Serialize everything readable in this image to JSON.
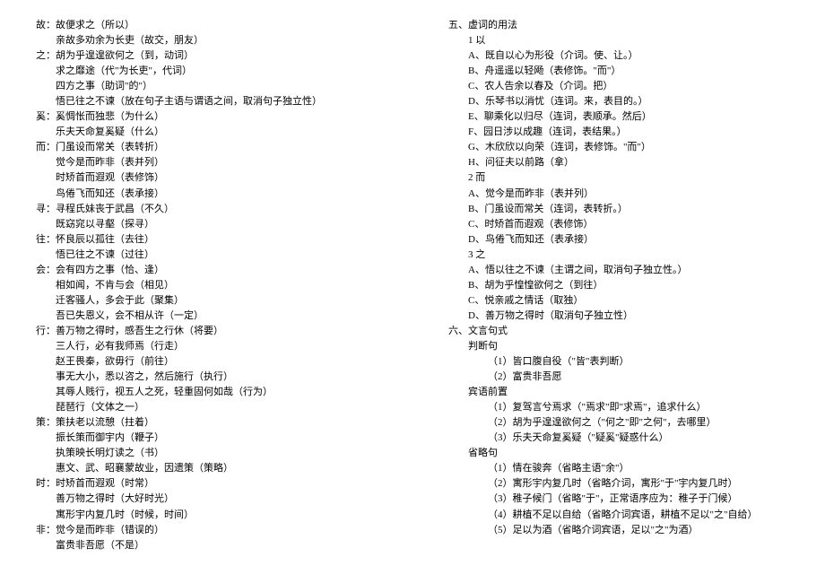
{
  "left": [
    {
      "indent": 0,
      "text": "故：故便求之（所以）"
    },
    {
      "indent": 1,
      "text": "亲故多劝余为长吏（故交，朋友）"
    },
    {
      "indent": 0,
      "text": "之：胡为乎遑遑欲何之（到，动词）"
    },
    {
      "indent": 1,
      "text": "求之靡途（代\"为长吏\"，代词）"
    },
    {
      "indent": 1,
      "text": "四方之事（助词\"的\"）"
    },
    {
      "indent": 1,
      "text": "悟已往之不谏（放在句子主语与谓语之间，取消句子独立性）"
    },
    {
      "indent": 0,
      "text": "奚：奚惆怅而独悲（为什么）"
    },
    {
      "indent": 1,
      "text": "乐夫天命复奚疑（什么）"
    },
    {
      "indent": 0,
      "text": "而：门虽设而常关（表转折）"
    },
    {
      "indent": 1,
      "text": "觉今是而昨非（表并列）"
    },
    {
      "indent": 1,
      "text": "时矫首而遐观（表修饰）"
    },
    {
      "indent": 1,
      "text": "鸟倦飞而知还（表承接）"
    },
    {
      "indent": 0,
      "text": "寻：寻程氏妹丧于武昌（不久）"
    },
    {
      "indent": 1,
      "text": "既窈窕以寻壑（探寻）"
    },
    {
      "indent": 0,
      "text": "往：怀良辰以孤往（去往）"
    },
    {
      "indent": 1,
      "text": "悟已往之不谏（过往）"
    },
    {
      "indent": 0,
      "text": "会：会有四方之事（恰、逢）"
    },
    {
      "indent": 1,
      "text": "相如闻，不肯与会（相见）"
    },
    {
      "indent": 1,
      "text": "迁客骚人，多会于此（聚集）"
    },
    {
      "indent": 1,
      "text": "吾已失恩义，会不相从许（一定）"
    },
    {
      "indent": 0,
      "text": "行：善万物之得时，感吾生之行休（将要）"
    },
    {
      "indent": 1,
      "text": "三人行，必有我师焉（行走）"
    },
    {
      "indent": 1,
      "text": "赵王畏秦，欲毋行（前往）"
    },
    {
      "indent": 1,
      "text": "事无大小，悉以咨之，然后施行（执行）"
    },
    {
      "indent": 1,
      "text": "其辱人贱行，视五人之死，轻重固何如哉（行为）"
    },
    {
      "indent": 1,
      "text": "琵琶行（文体之一）"
    },
    {
      "indent": 0,
      "text": "策：策扶老以流憩（拄着）"
    },
    {
      "indent": 1,
      "text": "振长策而御宇内（鞭子）"
    },
    {
      "indent": 1,
      "text": "执策映长明灯读之（书）"
    },
    {
      "indent": 1,
      "text": "惠文、武、昭襄蒙故业，因遗策（策略）"
    },
    {
      "indent": 0,
      "text": "时：时矫首而遐观（时常）"
    },
    {
      "indent": 1,
      "text": "善万物之得时（大好时光）"
    },
    {
      "indent": 1,
      "text": "寓形宇内复几时（时候，时间）"
    },
    {
      "indent": 0,
      "text": "非：觉今是而昨非（错误的）"
    },
    {
      "indent": 1,
      "text": "富贵非吾愿（不是）"
    }
  ],
  "right": [
    {
      "indent": 0,
      "text": "五、虚词的用法"
    },
    {
      "indent": 1,
      "text": "1 以"
    },
    {
      "indent": 1,
      "text": "A、既自以心为形役（介词。使、让。）"
    },
    {
      "indent": 1,
      "text": "B、舟遥遥以轻飏（表修饰。\"而\"）"
    },
    {
      "indent": 1,
      "text": "C、农人告余以春及（介词。把）"
    },
    {
      "indent": 1,
      "text": "D、乐琴书以消忧（连词。来，表目的。）"
    },
    {
      "indent": 1,
      "text": "E、聊乘化以归尽（连词，表顺承。然后）"
    },
    {
      "indent": 1,
      "text": "F、园日涉以成趣（连词，表结果。）"
    },
    {
      "indent": 1,
      "text": "G、木欣欣以向荣（连词，表修饰。\"而\"）"
    },
    {
      "indent": 1,
      "text": "H、问征夫以前路（拿）"
    },
    {
      "indent": 1,
      "text": "2 而"
    },
    {
      "indent": 1,
      "text": "A、觉今是而昨非（表并列）"
    },
    {
      "indent": 1,
      "text": "B、门虽设而常关（连词，表转折。）"
    },
    {
      "indent": 1,
      "text": "C、时矫首而遐观（表修饰）"
    },
    {
      "indent": 1,
      "text": "D、鸟倦飞而知还（表承接）"
    },
    {
      "indent": 1,
      "text": "3 之"
    },
    {
      "indent": 1,
      "text": "A、悟以往之不谏（主谓之间，取消句子独立性。）"
    },
    {
      "indent": 1,
      "text": "B、胡为乎惶惶欲何之（到往）"
    },
    {
      "indent": 1,
      "text": "C、悦亲戚之情话（取独）"
    },
    {
      "indent": 1,
      "text": "D、善万物之得时（取消句子独立性）"
    },
    {
      "indent": 0,
      "text": "六、文言句式"
    },
    {
      "indent": 1,
      "text": "判断句"
    },
    {
      "indent": 2,
      "text": "（1）皆口腹自役（\"皆\"表判断）"
    },
    {
      "indent": 2,
      "text": "（2）富贵非吾愿"
    },
    {
      "indent": 1,
      "text": "宾语前置"
    },
    {
      "indent": 2,
      "text": "（1）复驾言兮焉求（\"焉求\"即\"求焉\"，追求什么）"
    },
    {
      "indent": 2,
      "text": "（2）胡为乎遑遑欲何之（\"何之\"即\"之何\"，去哪里）"
    },
    {
      "indent": 2,
      "text": "（3）乐夫天命复奚疑（\"疑奚\"疑惑什么）"
    },
    {
      "indent": 1,
      "text": "省略句"
    },
    {
      "indent": 2,
      "text": "（1）情在骏奔（省略主语\"余\"）"
    },
    {
      "indent": 2,
      "text": "（2）寓形宇内复几时（省略介词，寓形\"于\"宇内复几时）"
    },
    {
      "indent": 2,
      "text": "（3）稚子候门（省略\"于\"，正常语序应为：稚子于门候）"
    },
    {
      "indent": 2,
      "text": "（4）耕植不足以自给（省略介词宾语，耕植不足以\"之\"自给）"
    },
    {
      "indent": 2,
      "text": "（5）足以为酒（省略介词宾语，足以\"之\"为酒）"
    }
  ]
}
